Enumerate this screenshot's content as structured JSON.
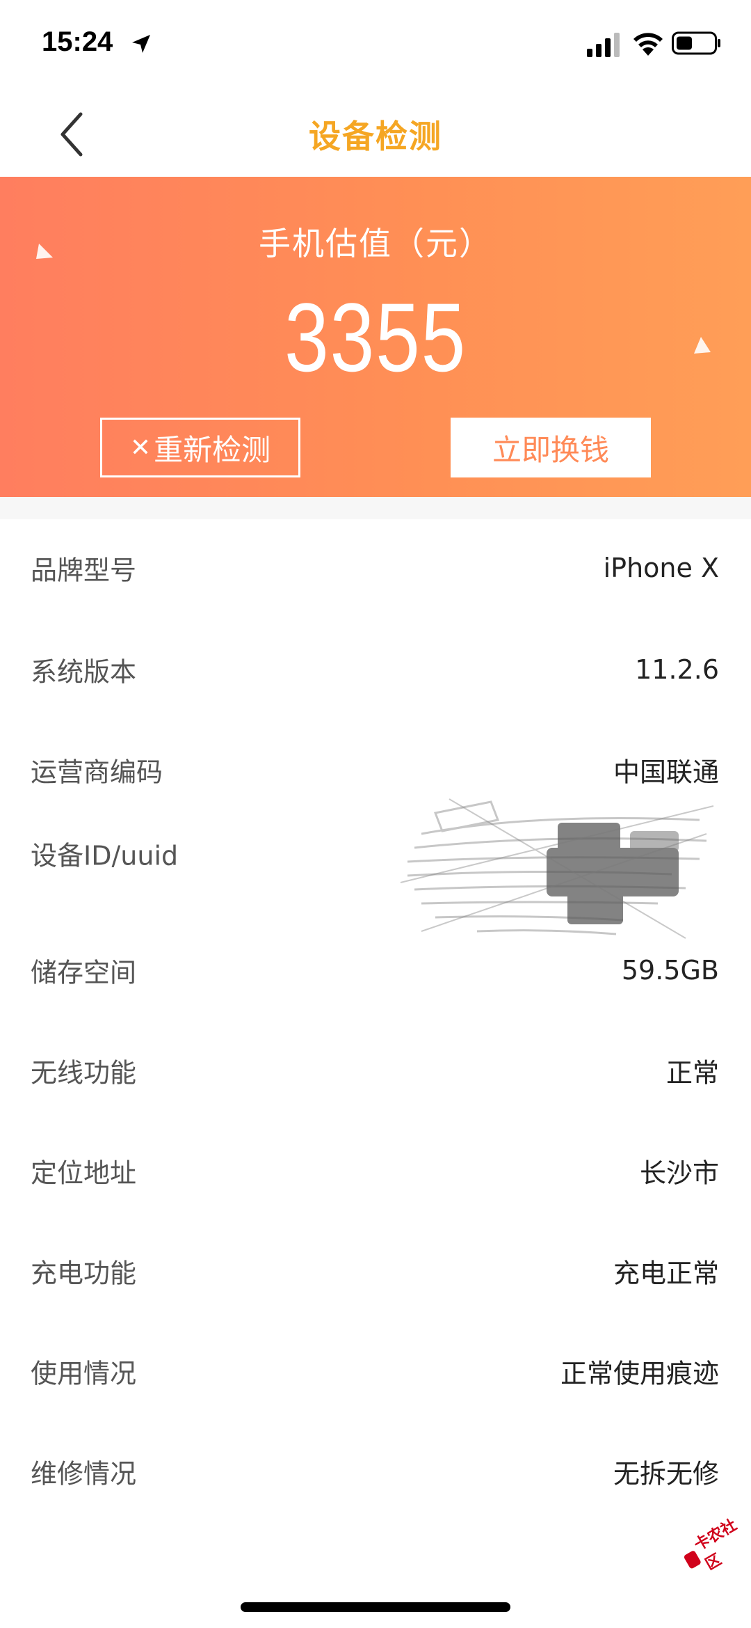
{
  "status_bar": {
    "time": "15:24"
  },
  "nav": {
    "title": "设备检测"
  },
  "banner": {
    "valuation_label": "手机估值（元）",
    "valuation_amount": "3355",
    "recheck_icon": "✕",
    "recheck_label": "重新检测",
    "exchange_label": "立即换钱"
  },
  "info": {
    "rows": [
      {
        "label": "品牌型号",
        "value": "iPhone X"
      },
      {
        "label": "系统版本",
        "value": "11.2.6"
      },
      {
        "label": "运营商编码",
        "value": "中国联通"
      },
      {
        "label": "设备ID/uuid",
        "value": ""
      },
      {
        "label": "储存空间",
        "value": "59.5GB"
      },
      {
        "label": "无线功能",
        "value": "正常"
      },
      {
        "label": "定位地址",
        "value": "长沙市"
      },
      {
        "label": "充电功能",
        "value": "充电正常"
      },
      {
        "label": "使用情况",
        "value": "正常使用痕迹"
      },
      {
        "label": "维修情况",
        "value": "无拆无修"
      }
    ]
  },
  "watermark": {
    "text": "卡农社区"
  },
  "colors": {
    "title_accent": "#f5a623",
    "banner_start": "#ff7e5f",
    "banner_end": "#ff9e57",
    "exchange_text": "#ff8a57"
  }
}
